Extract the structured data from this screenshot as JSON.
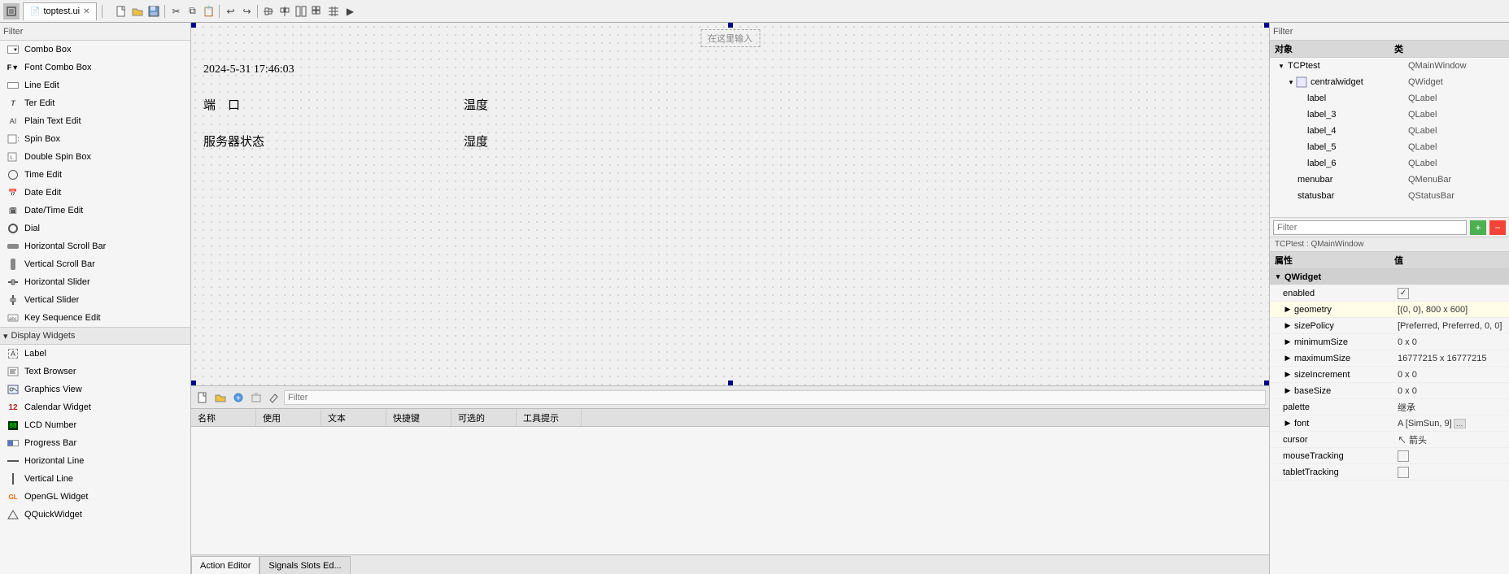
{
  "topbar": {
    "tab_label": "toptest.ui",
    "tab_icon": "file-icon"
  },
  "toolbar": {
    "icons": [
      "new",
      "open",
      "save",
      "save-as",
      "cut",
      "copy",
      "paste",
      "undo",
      "redo",
      "align-left",
      "align-center",
      "align-right",
      "align-top",
      "align-middle",
      "align-bottom",
      "grid",
      "grid2",
      "grid3",
      "preview"
    ]
  },
  "left_panel": {
    "filter_label": "Filter",
    "widgets": [
      {
        "name": "Combo Box",
        "icon": "combo-icon"
      },
      {
        "name": "Font Combo Box",
        "icon": "font-combo-icon"
      },
      {
        "name": "Line Edit",
        "icon": "line-edit-icon"
      },
      {
        "name": "Text Edit",
        "icon": "text-edit-icon"
      },
      {
        "name": "Plain Text Edit",
        "icon": "plain-text-edit-icon"
      },
      {
        "name": "Spin Box",
        "icon": "spin-box-icon"
      },
      {
        "name": "Double Spin Box",
        "icon": "double-spin-box-icon"
      },
      {
        "name": "Time Edit",
        "icon": "time-edit-icon"
      },
      {
        "name": "Date Edit",
        "icon": "date-edit-icon"
      },
      {
        "name": "Date/Time Edit",
        "icon": "datetime-edit-icon"
      },
      {
        "name": "Dial",
        "icon": "dial-icon"
      },
      {
        "name": "Horizontal Scroll Bar",
        "icon": "hscroll-icon"
      },
      {
        "name": "Vertical Scroll Bar",
        "icon": "vscroll-icon"
      },
      {
        "name": "Horizontal Slider",
        "icon": "hslider-icon"
      },
      {
        "name": "Vertical Slider",
        "icon": "vslider-icon"
      },
      {
        "name": "Key Sequence Edit",
        "icon": "keyseq-icon"
      }
    ],
    "section_display": "Display Widgets",
    "display_widgets": [
      {
        "name": "Label",
        "icon": "label-icon"
      },
      {
        "name": "Text Browser",
        "icon": "textbrowser-icon"
      },
      {
        "name": "Graphics View",
        "icon": "graphicsview-icon"
      },
      {
        "name": "Calendar Widget",
        "icon": "calendar-icon"
      },
      {
        "name": "LCD Number",
        "icon": "lcd-icon"
      },
      {
        "name": "Progress Bar",
        "icon": "progress-icon"
      },
      {
        "name": "Horizontal Line",
        "icon": "hline-icon"
      },
      {
        "name": "Vertical Line",
        "icon": "vline-icon"
      },
      {
        "name": "OpenGL Widget",
        "icon": "opengl-icon"
      },
      {
        "name": "QQuickWidget",
        "icon": "qquick-icon"
      }
    ]
  },
  "canvas": {
    "input_hint": "在这里输入",
    "datetime_text": "2024-5-31 17:46:03",
    "label1": "端　口",
    "label2": "温度",
    "label3": "服务器状态",
    "label4": "湿度"
  },
  "action_bar": {
    "icons": [
      "action-new",
      "action-open",
      "action-add",
      "action-delete",
      "action-edit"
    ],
    "filter_placeholder": "Filter"
  },
  "bottom_table": {
    "columns": [
      "名称",
      "使用",
      "文本",
      "快捷键",
      "可选的",
      "工具提示"
    ],
    "rows": []
  },
  "bottom_tabs": [
    {
      "label": "Action Editor",
      "active": true
    },
    {
      "label": "Signals Slots Ed...",
      "active": false
    }
  ],
  "right_panel": {
    "filter_label": "Filter",
    "tree_headers": [
      "对象",
      "类"
    ],
    "tree": [
      {
        "indent": 0,
        "expand": true,
        "name": "TCPtest",
        "type": "QMainWindow",
        "selected": false
      },
      {
        "indent": 1,
        "expand": true,
        "name": "centralwidget",
        "type": "QWidget",
        "selected": false
      },
      {
        "indent": 2,
        "expand": false,
        "name": "label",
        "type": "QLabel",
        "selected": false
      },
      {
        "indent": 2,
        "expand": false,
        "name": "label_3",
        "type": "QLabel",
        "selected": false
      },
      {
        "indent": 2,
        "expand": false,
        "name": "label_4",
        "type": "QLabel",
        "selected": false
      },
      {
        "indent": 2,
        "expand": false,
        "name": "label_5",
        "type": "QLabel",
        "selected": false
      },
      {
        "indent": 2,
        "expand": false,
        "name": "label_6",
        "type": "QLabel",
        "selected": false
      },
      {
        "indent": 1,
        "expand": false,
        "name": "menubar",
        "type": "QMenuBar",
        "selected": false
      },
      {
        "indent": 1,
        "expand": false,
        "name": "statusbar",
        "type": "QStatusBar",
        "selected": false
      }
    ]
  },
  "properties": {
    "filter_placeholder": "Filter",
    "context_label": "TCPtest : QMainWindow",
    "headers": [
      "属性",
      "值"
    ],
    "rows": [
      {
        "type": "section",
        "name": "QWidget",
        "expand": true,
        "indent": 0
      },
      {
        "type": "prop",
        "name": "enabled",
        "value": "☑",
        "is_checkbox": true,
        "indent": 1,
        "selected": false
      },
      {
        "type": "prop",
        "name": "geometry",
        "value": "[(0, 0), 800 x 600]",
        "indent": 1,
        "selected": true,
        "highlighted": true
      },
      {
        "type": "prop",
        "name": "sizePolicy",
        "value": "[Preferred, Preferred, 0, 0]",
        "indent": 1
      },
      {
        "type": "prop",
        "name": "minimumSize",
        "value": "0 x 0",
        "indent": 1
      },
      {
        "type": "prop",
        "name": "maximumSize",
        "value": "16777215 x 16777215",
        "indent": 1
      },
      {
        "type": "prop",
        "name": "sizeIncrement",
        "value": "0 x 0",
        "indent": 1
      },
      {
        "type": "prop",
        "name": "baseSize",
        "value": "0 x 0",
        "indent": 1
      },
      {
        "type": "prop",
        "name": "palette",
        "value": "继承",
        "indent": 1
      },
      {
        "type": "prop",
        "name": "font",
        "value": "A [SimSun, 9]",
        "indent": 1,
        "has_edit": true
      },
      {
        "type": "prop",
        "name": "cursor",
        "value": "↖ 箭头",
        "indent": 1
      },
      {
        "type": "prop",
        "name": "mouseTracking",
        "value": "☐",
        "is_checkbox": true,
        "indent": 1
      },
      {
        "type": "prop",
        "name": "tabletTracking",
        "value": "☐",
        "is_checkbox": true,
        "indent": 1
      }
    ]
  }
}
